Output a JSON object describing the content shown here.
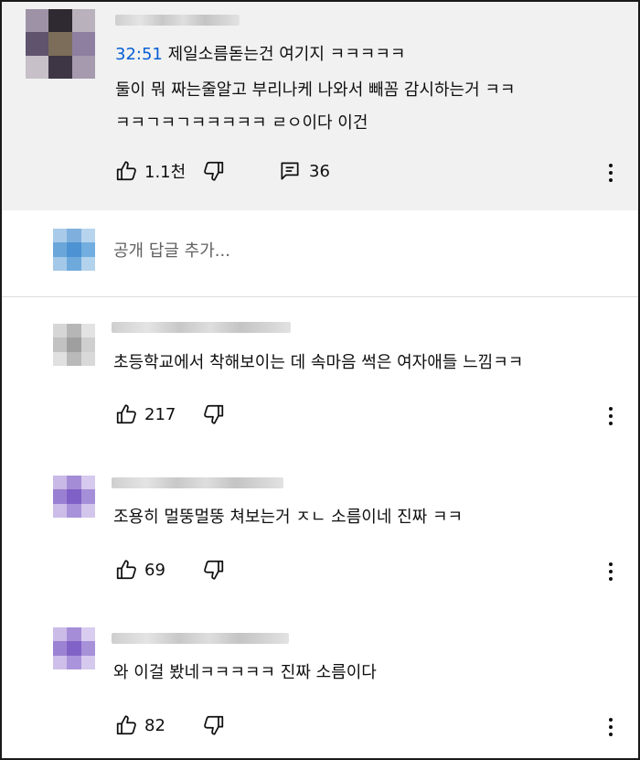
{
  "top_comment": {
    "timestamp": "32:51",
    "line1_rest": " 제일소름돋는건 여기지 ㅋㅋㅋㅋㅋ",
    "line2": "둘이 뭐 짜는줄알고 부리나케 나와서 빼꼼 감시하는거 ㅋㅋ",
    "line3": "ㅋㅋㄱㅋㄱㅋㅋㅋㅋㅋ ㄹㅇ이다 이건",
    "like_count": "1.1천",
    "reply_count": "36"
  },
  "reply_box": {
    "placeholder": "공개 답글 추가..."
  },
  "replies": [
    {
      "text": "초등학교에서 착해보이는 데 속마음 썩은 여자애들 느낌ㅋㅋ",
      "like_count": "217"
    },
    {
      "text": "조용히 멀뚱멀뚱 쳐보는거 ㅈㄴ 소름이네 진짜 ㅋㅋ",
      "like_count": "69"
    },
    {
      "text": "와 이걸 봤네ㅋㅋㅋㅋㅋ 진짜 소름이다",
      "like_count": "82"
    }
  ],
  "icons": {
    "like": "thumbs-up-icon",
    "dislike": "thumbs-down-icon",
    "replies": "comment-icon",
    "more": "more-vertical-icon"
  },
  "colors": {
    "link": "#065fd4",
    "highlight_bg": "#f1f1f1",
    "text": "#0f0f0f",
    "secondary": "#606060"
  }
}
